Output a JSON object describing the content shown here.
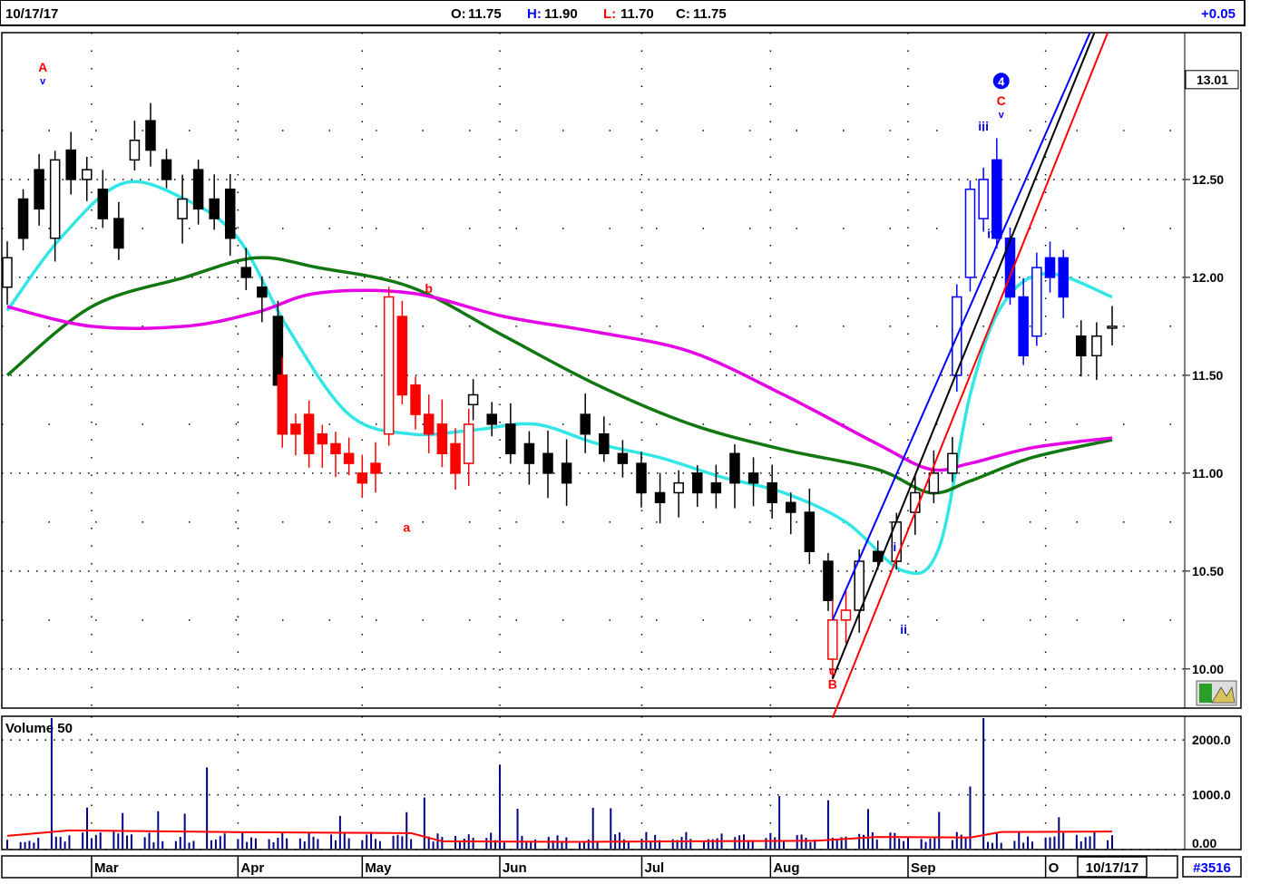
{
  "header": {
    "date": "10/17/17",
    "open_label": "O:",
    "open": "11.75",
    "high_label": "H:",
    "high": "11.90",
    "low_label": "L:",
    "low": "11.70",
    "close_label": "C:",
    "close": "11.75",
    "change": "+0.05"
  },
  "volume_panel": {
    "title": "Volume 50"
  },
  "footer": {
    "current_date": "10/17/17",
    "symbol_id": "#3516"
  },
  "colors": {
    "bar_down": "#000000",
    "bar_red": "#ff0000",
    "bar_blue": "#0000ff",
    "ma_fast": "#33e6e6",
    "ma_mid": "#117711",
    "ma_slow": "#e600e6",
    "trend_blue": "#0000ff",
    "trend_black": "#000000",
    "trend_red": "#ff0000",
    "volume_bar": "#000080",
    "volume_avg": "#ff0000",
    "label_red": "#ff0000",
    "label_blue": "#0000ff"
  },
  "chart_data": [
    {
      "type": "candlestick",
      "x_axis": {
        "type": "date",
        "range": [
          "2017-02-10",
          "2017-10-17"
        ],
        "month_labels": [
          {
            "label": "Mar",
            "date": "2017-03-01"
          },
          {
            "label": "Apr",
            "date": "2017-04-03"
          },
          {
            "label": "May",
            "date": "2017-05-01"
          },
          {
            "label": "Jun",
            "date": "2017-06-01"
          },
          {
            "label": "Jul",
            "date": "2017-07-03"
          },
          {
            "label": "Aug",
            "date": "2017-08-01"
          },
          {
            "label": "Sep",
            "date": "2017-09-01"
          },
          {
            "label": "O",
            "date": "2017-10-02"
          }
        ]
      },
      "y_axis": {
        "range": [
          9.8,
          13.25
        ],
        "position": "right",
        "ticks": [
          "10.00",
          "10.50",
          "11.00",
          "11.50",
          "12.00",
          "12.50"
        ],
        "last_price_label": "13.01",
        "last_price_value": 13.01
      },
      "grid": true,
      "segments": [
        {
          "color": "black",
          "start": "2017-02-10",
          "end": "2017-04-12",
          "points": [
            [
              11.95,
              12.1
            ],
            [
              12.4,
              12.2
            ],
            [
              12.55,
              12.35
            ],
            [
              12.2,
              12.6
            ],
            [
              12.65,
              12.5
            ],
            [
              12.5,
              12.55
            ],
            [
              12.45,
              12.3
            ],
            [
              12.3,
              12.15
            ],
            [
              12.6,
              12.7
            ],
            [
              12.8,
              12.65
            ],
            [
              12.6,
              12.5
            ],
            [
              12.3,
              12.4
            ],
            [
              12.55,
              12.35
            ],
            [
              12.4,
              12.3
            ],
            [
              12.45,
              12.2
            ],
            [
              12.05,
              12.0
            ],
            [
              11.95,
              11.9
            ],
            [
              11.8,
              11.45
            ]
          ]
        },
        {
          "color": "red",
          "start": "2017-04-13",
          "end": "2017-05-25",
          "points": [
            [
              11.5,
              11.2
            ],
            [
              11.25,
              11.2
            ],
            [
              11.3,
              11.1
            ],
            [
              11.2,
              11.15
            ],
            [
              11.15,
              11.1
            ],
            [
              11.1,
              11.05
            ],
            [
              11.0,
              10.95
            ],
            [
              11.05,
              11.0
            ],
            [
              11.2,
              11.9
            ],
            [
              11.8,
              11.4
            ],
            [
              11.45,
              11.3
            ],
            [
              11.3,
              11.2
            ],
            [
              11.25,
              11.1
            ],
            [
              11.15,
              11.0
            ],
            [
              11.05,
              11.25
            ]
          ]
        },
        {
          "color": "black",
          "start": "2017-05-26",
          "end": "2017-08-14",
          "points": [
            [
              11.35,
              11.4
            ],
            [
              11.3,
              11.25
            ],
            [
              11.25,
              11.1
            ],
            [
              11.15,
              11.05
            ],
            [
              11.1,
              11.0
            ],
            [
              11.05,
              10.95
            ],
            [
              11.3,
              11.2
            ],
            [
              11.2,
              11.1
            ],
            [
              11.1,
              11.05
            ],
            [
              11.05,
              10.9
            ],
            [
              10.9,
              10.85
            ],
            [
              10.9,
              10.95
            ],
            [
              11.0,
              10.9
            ],
            [
              10.95,
              10.9
            ],
            [
              11.1,
              10.95
            ],
            [
              11.0,
              10.95
            ],
            [
              10.95,
              10.85
            ],
            [
              10.85,
              10.8
            ],
            [
              10.8,
              10.6
            ],
            [
              10.55,
              10.35
            ]
          ]
        },
        {
          "color": "red",
          "start": "2017-08-15",
          "end": "2017-08-18",
          "points": [
            [
              10.05,
              10.25
            ],
            [
              10.25,
              10.3
            ]
          ]
        },
        {
          "color": "black",
          "start": "2017-08-21",
          "end": "2017-09-11",
          "points": [
            [
              10.3,
              10.55
            ],
            [
              10.6,
              10.55
            ],
            [
              10.55,
              10.75
            ],
            [
              10.8,
              10.9
            ],
            [
              10.9,
              11.0
            ],
            [
              11.0,
              11.1
            ]
          ]
        },
        {
          "color": "blue",
          "start": "2017-09-12",
          "end": "2017-10-06",
          "points": [
            [
              11.5,
              11.9
            ],
            [
              12.0,
              12.45
            ],
            [
              12.3,
              12.5
            ],
            [
              12.6,
              12.2
            ],
            [
              12.2,
              11.9
            ],
            [
              11.9,
              11.6
            ],
            [
              11.7,
              12.05
            ],
            [
              12.1,
              12.0
            ],
            [
              12.1,
              11.9
            ]
          ]
        },
        {
          "color": "black",
          "start": "2017-10-10",
          "end": "2017-10-17",
          "points": [
            [
              11.7,
              11.6
            ],
            [
              11.6,
              11.7
            ],
            [
              11.75,
              11.75
            ]
          ]
        }
      ],
      "moving_averages": [
        {
          "color": "cyan",
          "points": [
            [
              "2017-02-10",
              11.83
            ],
            [
              "2017-02-22",
              12.2
            ],
            [
              "2017-03-08",
              12.48
            ],
            [
              "2017-03-22",
              12.4
            ],
            [
              "2017-04-03",
              12.2
            ],
            [
              "2017-04-14",
              11.75
            ],
            [
              "2017-04-28",
              11.3
            ],
            [
              "2017-05-12",
              11.2
            ],
            [
              "2017-05-26",
              11.22
            ],
            [
              "2017-06-09",
              11.25
            ],
            [
              "2017-06-23",
              11.15
            ],
            [
              "2017-07-07",
              11.08
            ],
            [
              "2017-07-21",
              10.98
            ],
            [
              "2017-08-04",
              10.9
            ],
            [
              "2017-08-18",
              10.75
            ],
            [
              "2017-08-31",
              10.5
            ],
            [
              "2017-09-08",
              10.62
            ],
            [
              "2017-09-15",
              11.4
            ],
            [
              "2017-09-22",
              11.85
            ],
            [
              "2017-10-02",
              12.02
            ],
            [
              "2017-10-17",
              11.9
            ]
          ]
        },
        {
          "color": "green",
          "points": [
            [
              "2017-02-10",
              11.5
            ],
            [
              "2017-03-01",
              11.85
            ],
            [
              "2017-03-22",
              12.0
            ],
            [
              "2017-04-07",
              12.1
            ],
            [
              "2017-04-21",
              12.05
            ],
            [
              "2017-05-12",
              11.95
            ],
            [
              "2017-06-02",
              11.7
            ],
            [
              "2017-06-23",
              11.45
            ],
            [
              "2017-07-14",
              11.25
            ],
            [
              "2017-08-04",
              11.12
            ],
            [
              "2017-08-25",
              11.02
            ],
            [
              "2017-09-06",
              10.9
            ],
            [
              "2017-09-15",
              10.96
            ],
            [
              "2017-09-29",
              11.08
            ],
            [
              "2017-10-17",
              11.17
            ]
          ]
        },
        {
          "color": "magenta",
          "points": [
            [
              "2017-02-10",
              11.85
            ],
            [
              "2017-03-01",
              11.75
            ],
            [
              "2017-03-22",
              11.75
            ],
            [
              "2017-04-07",
              11.82
            ],
            [
              "2017-04-21",
              11.92
            ],
            [
              "2017-05-12",
              11.92
            ],
            [
              "2017-06-02",
              11.8
            ],
            [
              "2017-06-23",
              11.72
            ],
            [
              "2017-07-14",
              11.62
            ],
            [
              "2017-08-04",
              11.4
            ],
            [
              "2017-08-25",
              11.15
            ],
            [
              "2017-09-06",
              11.02
            ],
            [
              "2017-09-15",
              11.05
            ],
            [
              "2017-09-29",
              11.13
            ],
            [
              "2017-10-17",
              11.18
            ]
          ]
        }
      ],
      "trend_lines": [
        {
          "color": "blue",
          "from": [
            "2017-08-15",
            10.25
          ],
          "to": [
            "2017-10-12",
            13.25
          ]
        },
        {
          "color": "black",
          "from": [
            "2017-08-15",
            9.95
          ],
          "to": [
            "2017-10-13",
            13.25
          ]
        },
        {
          "color": "red",
          "from": [
            "2017-08-15",
            9.75
          ],
          "to": [
            "2017-10-16",
            13.25
          ]
        }
      ],
      "annotations": [
        {
          "text": "A",
          "date": "2017-02-18",
          "value": 13.05,
          "color": "red",
          "marker": "v"
        },
        {
          "text": "a",
          "date": "2017-05-11",
          "value": 10.7,
          "color": "red"
        },
        {
          "text": "b",
          "date": "2017-05-16",
          "value": 11.92,
          "color": "red"
        },
        {
          "text": "c",
          "date": "2017-08-15",
          "value": 9.97,
          "color": "red"
        },
        {
          "text": "B",
          "date": "2017-08-15",
          "value": 9.9,
          "color": "red"
        },
        {
          "text": "i",
          "date": "2017-08-29",
          "value": 10.6,
          "color": "blue"
        },
        {
          "text": "ii",
          "date": "2017-08-31",
          "value": 10.18,
          "color": "blue"
        },
        {
          "text": "iii",
          "date": "2017-09-18",
          "value": 12.75,
          "color": "blue"
        },
        {
          "text": "iv",
          "date": "2017-09-20",
          "value": 12.2,
          "color": "blue"
        },
        {
          "text": "C",
          "date": "2017-09-22",
          "value": 12.88,
          "color": "red",
          "marker": "v"
        },
        {
          "text": "4",
          "date": "2017-09-22",
          "value": 12.98,
          "color": "blue",
          "circled": true
        }
      ]
    },
    {
      "type": "bar",
      "title": "Volume 50",
      "y_axis": {
        "range": [
          0,
          2400
        ],
        "ticks": [
          "2000.0",
          "1000.0",
          "0.00"
        ]
      },
      "spikes": [
        {
          "date": "2017-02-20",
          "value": 2500
        },
        {
          "date": "2017-03-27",
          "value": 1500
        },
        {
          "date": "2017-05-15",
          "value": 950
        },
        {
          "date": "2017-06-01",
          "value": 1550
        },
        {
          "date": "2017-08-03",
          "value": 980
        },
        {
          "date": "2017-08-14",
          "value": 900
        },
        {
          "date": "2017-09-18",
          "value": 2500
        },
        {
          "date": "2017-09-15",
          "value": 1150
        }
      ],
      "typical_volume": 300,
      "average_line": [
        [
          "2017-02-10",
          250
        ],
        [
          "2017-02-24",
          350
        ],
        [
          "2017-03-31",
          320
        ],
        [
          "2017-05-12",
          300
        ],
        [
          "2017-05-19",
          150
        ],
        [
          "2017-06-16",
          140
        ],
        [
          "2017-08-11",
          160
        ],
        [
          "2017-08-25",
          230
        ],
        [
          "2017-09-15",
          220
        ],
        [
          "2017-09-22",
          320
        ],
        [
          "2017-10-17",
          330
        ]
      ]
    }
  ]
}
